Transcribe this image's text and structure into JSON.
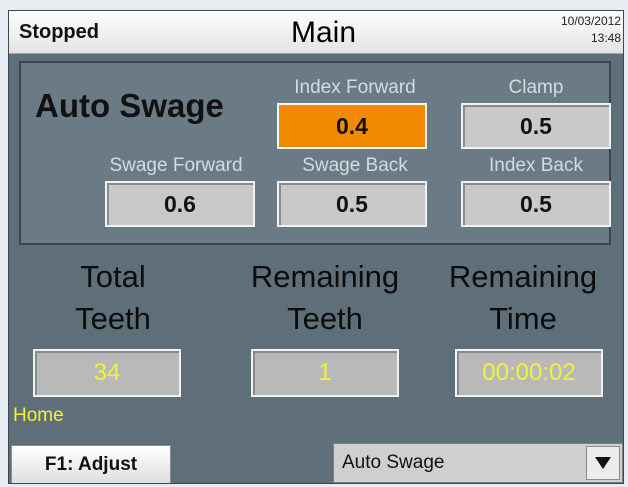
{
  "header": {
    "status": "Stopped",
    "title": "Main",
    "date": "10/03/2012",
    "time": "13:48"
  },
  "auto_swage": {
    "title": "Auto Swage",
    "index_forward": {
      "label": "Index Forward",
      "value": "0.4"
    },
    "clamp": {
      "label": "Clamp",
      "value": "0.5"
    },
    "swage_forward": {
      "label": "Swage Forward",
      "value": "0.6"
    },
    "swage_back": {
      "label": "Swage Back",
      "value": "0.5"
    },
    "index_back": {
      "label": "Index Back",
      "value": "0.5"
    }
  },
  "counters": {
    "total_teeth": {
      "label_line1": "Total",
      "label_line2": "Teeth",
      "value": "34"
    },
    "remaining_teeth": {
      "label_line1": "Remaining",
      "label_line2": "Teeth",
      "value": "1"
    },
    "remaining_time": {
      "label_line1": "Remaining",
      "label_line2": "Time",
      "value": "00:00:02"
    }
  },
  "footer": {
    "home_link": "Home",
    "f1_button": "F1: Adjust",
    "mode_select": "Auto Swage"
  },
  "colors": {
    "background": "#5f6f7a",
    "active_field": "#f28a00",
    "counter_text": "#f3f13a"
  },
  "icons": {
    "dropdown": "triangle-down-icon"
  }
}
